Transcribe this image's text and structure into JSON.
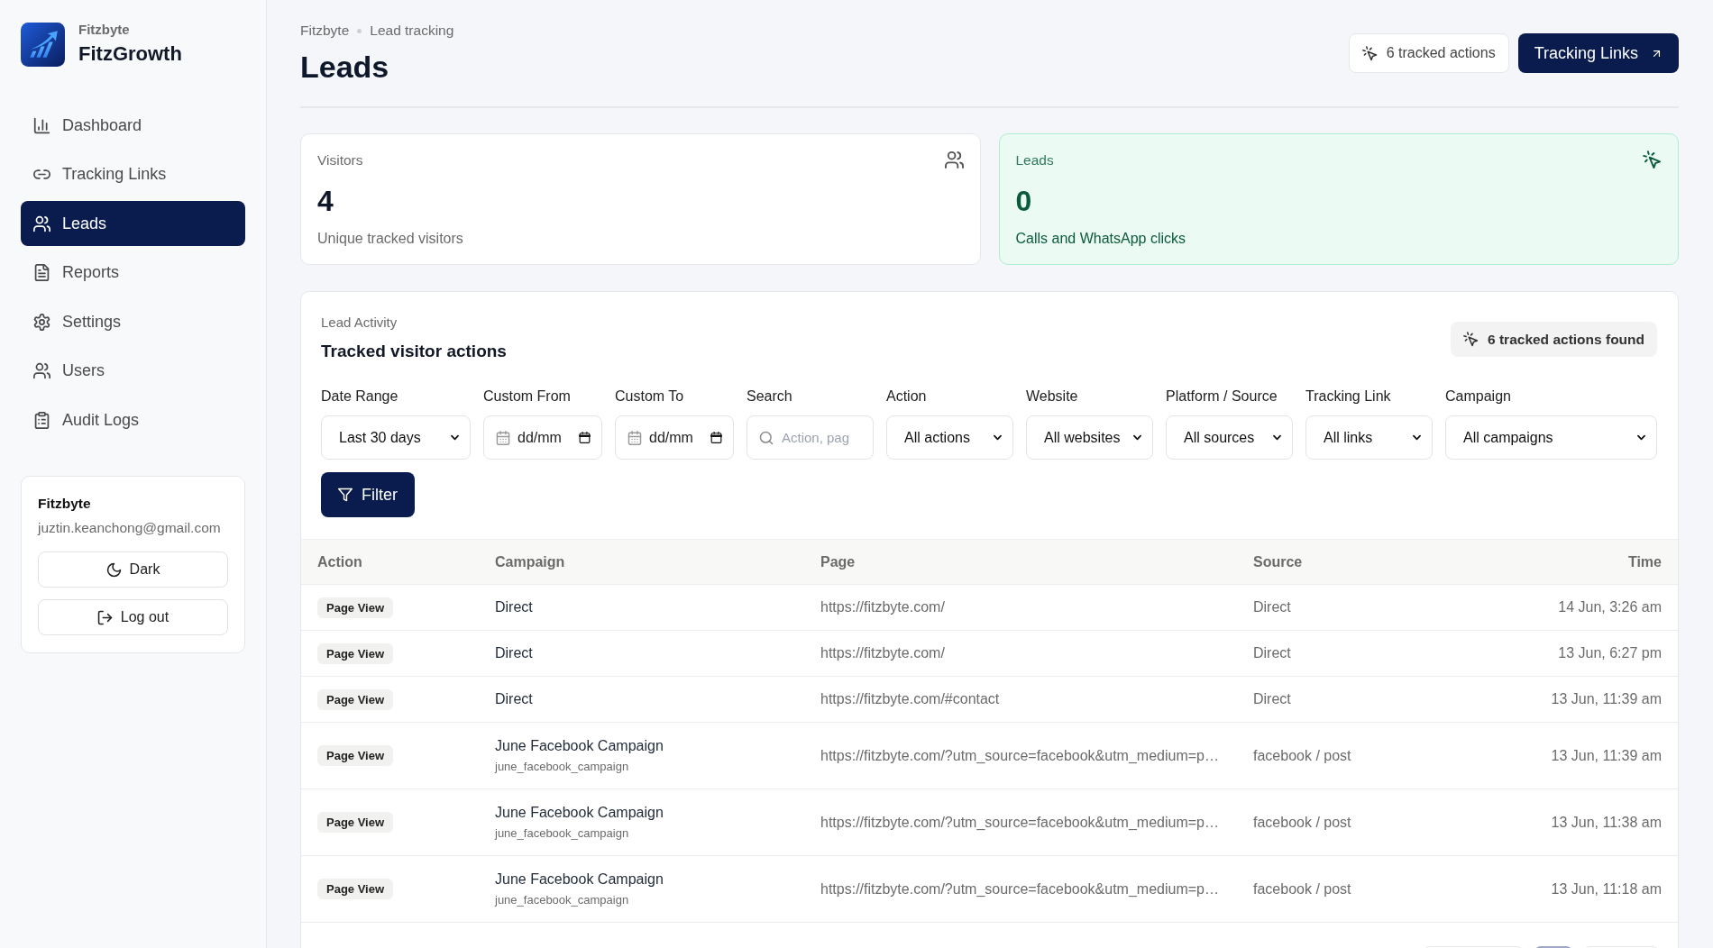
{
  "sidebar": {
    "brand": {
      "org": "Fitzbyte",
      "name": "FitzGrowth"
    },
    "nav": [
      {
        "label": "Dashboard",
        "selected": false
      },
      {
        "label": "Tracking Links",
        "selected": false
      },
      {
        "label": "Leads",
        "selected": true
      },
      {
        "label": "Reports",
        "selected": false
      },
      {
        "label": "Settings",
        "selected": false
      },
      {
        "label": "Users",
        "selected": false
      },
      {
        "label": "Audit Logs",
        "selected": false
      }
    ],
    "account": {
      "name": "Fitzbyte",
      "email": "juztin.keanchong@gmail.com",
      "buttons": [
        "Dark",
        "Log out"
      ]
    }
  },
  "header": {
    "breadcrumb": [
      "Fitzbyte",
      "Lead tracking"
    ],
    "title": "Leads",
    "tracked_badge": "6 tracked actions",
    "primary_button": "Tracking Links"
  },
  "stats": [
    {
      "kind": "neutral",
      "label": "Visitors",
      "value": "4",
      "caption": "Unique tracked visitors"
    },
    {
      "kind": "highlight",
      "label": "Leads",
      "value": "0",
      "caption": "Calls and WhatsApp clicks"
    }
  ],
  "activity": {
    "eyebrow": "Lead Activity",
    "title": "Tracked visitor actions",
    "found_badge": "6 tracked actions found",
    "filters": [
      {
        "kind": "select",
        "label": "Date Range",
        "value": "Last 30 days"
      },
      {
        "kind": "date",
        "label": "Custom From",
        "placeholder": "dd/mm"
      },
      {
        "kind": "date",
        "label": "Custom To",
        "placeholder": "dd/mm"
      },
      {
        "kind": "search",
        "label": "Search",
        "placeholder": "Action, pag"
      },
      {
        "kind": "select",
        "label": "Action",
        "value": "All actions"
      },
      {
        "kind": "select",
        "label": "Website",
        "value": "All websites"
      },
      {
        "kind": "select",
        "label": "Platform / Source",
        "value": "All sources"
      },
      {
        "kind": "select",
        "label": "Tracking Link",
        "value": "All links"
      },
      {
        "kind": "select",
        "label": "Campaign",
        "value": "All campaigns"
      }
    ],
    "filter_button": "Filter",
    "table": {
      "columns": [
        "Action",
        "Campaign",
        "Page",
        "Source",
        "Time"
      ],
      "rows": [
        {
          "action": "Page View",
          "campaign": "Direct",
          "page": "https://fitzbyte.com/",
          "source": "Direct",
          "time": "14 Jun, 3:26 am"
        },
        {
          "action": "Page View",
          "campaign": "Direct",
          "page": "https://fitzbyte.com/",
          "source": "Direct",
          "time": "13 Jun, 6:27 pm"
        },
        {
          "action": "Page View",
          "campaign": "Direct",
          "page": "https://fitzbyte.com/#contact",
          "source": "Direct",
          "time": "13 Jun, 11:39 am"
        },
        {
          "action": "Page View",
          "campaign": "June Facebook Campaign",
          "campaign_id": "june_facebook_campaign",
          "page": "https://fitzbyte.com/?utm_source=facebook&utm_medium=p…",
          "source": "facebook / post",
          "time": "13 Jun, 11:39 am"
        },
        {
          "action": "Page View",
          "campaign": "June Facebook Campaign",
          "campaign_id": "june_facebook_campaign",
          "page": "https://fitzbyte.com/?utm_source=facebook&utm_medium=p…",
          "source": "facebook / post",
          "time": "13 Jun, 11:38 am"
        },
        {
          "action": "Page View",
          "campaign": "June Facebook Campaign",
          "campaign_id": "june_facebook_campaign",
          "page": "https://fitzbyte.com/?utm_source=facebook&utm_medium=p…",
          "source": "facebook / post",
          "time": "13 Jun, 11:18 am"
        }
      ]
    },
    "pagination": [
      {
        "selected": false
      },
      {
        "selected": true
      },
      {
        "selected": false
      }
    ]
  }
}
